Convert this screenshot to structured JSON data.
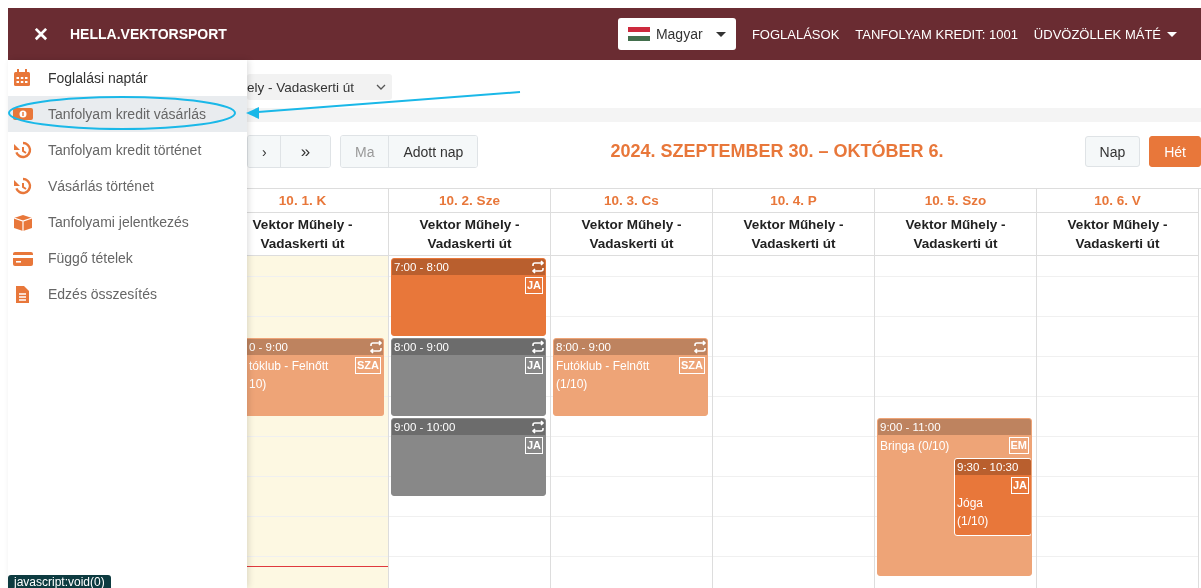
{
  "header": {
    "brand": "HELLA.VEKTORSPORT",
    "close_icon": "✕",
    "language": "Magyar",
    "links": [
      "FOGLALÁSOK",
      "TANFOLYAM KREDIT: 1001"
    ],
    "user": "ÜDVÖZÖLLEK MÁTÉ"
  },
  "sidebar": {
    "items": [
      {
        "label": "Foglalási naptár",
        "selected": false
      },
      {
        "label": "Tanfolyam kredit vásárlás",
        "selected": true
      },
      {
        "label": "Tanfolyam kredit történet",
        "selected": false
      },
      {
        "label": "Vásárlás történet",
        "selected": false
      },
      {
        "label": "Tanfolyami jelentkezés",
        "selected": false
      },
      {
        "label": "Függő tételek",
        "selected": false
      },
      {
        "label": "Edzés összesítés",
        "selected": false
      }
    ]
  },
  "location_select": {
    "value": "ely - Vadaskerti út"
  },
  "toolbar": {
    "nav_buttons": [
      "›",
      "»"
    ],
    "day_buttons": [
      {
        "label": "Ma",
        "disabled": true
      },
      {
        "label": "Adott nap",
        "disabled": false
      }
    ],
    "title": "2024. SZEPTEMBER 30. – OKTÓBER 6.",
    "view_buttons": [
      {
        "label": "Nap",
        "selected": false
      },
      {
        "label": "Hét",
        "selected": true
      }
    ]
  },
  "days": [
    {
      "date": "10. 1. K",
      "location": "Vektor Műhely - Vadaskerti út",
      "today": true,
      "events": [
        {
          "time": "0 - 9:00",
          "title": "tóklub - Felnőtt",
          "count": "10)",
          "badge": "SZA",
          "color": "#eea477",
          "recurring": true
        }
      ]
    },
    {
      "date": "10. 2. Sze",
      "location": "Vektor Műhely - Vadaskerti út",
      "today": false,
      "events": [
        {
          "time": "7:00 - 8:00",
          "badge": "JA",
          "color": "#e8773a",
          "recurring": true
        },
        {
          "time": "8:00 - 9:00",
          "badge": "JA",
          "color": "#888888",
          "recurring": true
        },
        {
          "time": "9:00 - 10:00",
          "badge": "JA",
          "color": "#888888",
          "recurring": true
        }
      ]
    },
    {
      "date": "10. 3. Cs",
      "location": "Vektor Műhely - Vadaskerti út",
      "today": false,
      "events": [
        {
          "time": "8:00 - 9:00",
          "title": "Futóklub - Felnőtt",
          "count": "(1/10)",
          "badge": "SZA",
          "color": "#eea477",
          "recurring": true
        }
      ]
    },
    {
      "date": "10. 4. P",
      "location": "Vektor Műhely - Vadaskerti út",
      "today": false
    },
    {
      "date": "10. 5. Szo",
      "location": "Vektor Műhely - Vadaskerti út",
      "today": false,
      "events": [
        {
          "time": "9:00 - 11:00",
          "title": "Bringa (0/10)",
          "badge": "EM",
          "color": "#eea477",
          "recurring": false
        },
        {
          "time": "9:30 - 10:30",
          "title": "Jóga",
          "count": "(1/10)",
          "badge": "JA",
          "color": "#e8773a",
          "recurring": false
        }
      ]
    },
    {
      "date": "10. 6. V",
      "location": "Vektor Műhely - Vadaskerti út",
      "today": false
    }
  ],
  "status_link": "javascript:void(0)"
}
